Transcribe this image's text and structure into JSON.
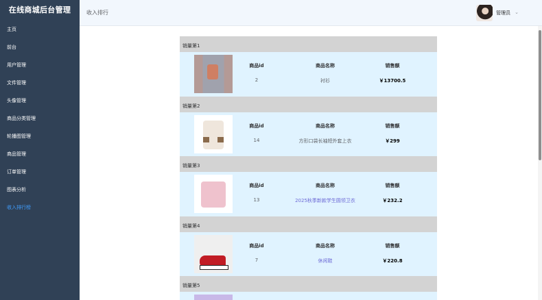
{
  "app": {
    "title": "在线商城后台管理"
  },
  "sidebar": {
    "items": [
      {
        "label": "主页"
      },
      {
        "label": "前台"
      },
      {
        "label": "用户管理"
      },
      {
        "label": "文件管理"
      },
      {
        "label": "头像管理"
      },
      {
        "label": "商品分类管理"
      },
      {
        "label": "轮播图管理"
      },
      {
        "label": "商品管理"
      },
      {
        "label": "订单管理"
      },
      {
        "label": "图表分析"
      },
      {
        "label": "收入排行榜"
      }
    ],
    "active_index": 10
  },
  "header": {
    "title": "收入排行",
    "user_name": "管理员"
  },
  "table_headers": {
    "id": "商品id",
    "name": "商品名称",
    "sales": "销售额"
  },
  "ranks": [
    {
      "title": "销量第1",
      "id": "2",
      "name": "衬衫",
      "sales": "￥13700.5"
    },
    {
      "title": "销量第2",
      "id": "14",
      "name": "方形口袋长袖短外套上衣",
      "sales": "￥299"
    },
    {
      "title": "销量第3",
      "id": "13",
      "name": "2025秋季新款学生圆领卫衣",
      "sales": "￥232.2"
    },
    {
      "title": "销量第4",
      "id": "7",
      "name": "休闲鞋",
      "sales": "￥220.8"
    },
    {
      "title": "销量第5"
    }
  ]
}
